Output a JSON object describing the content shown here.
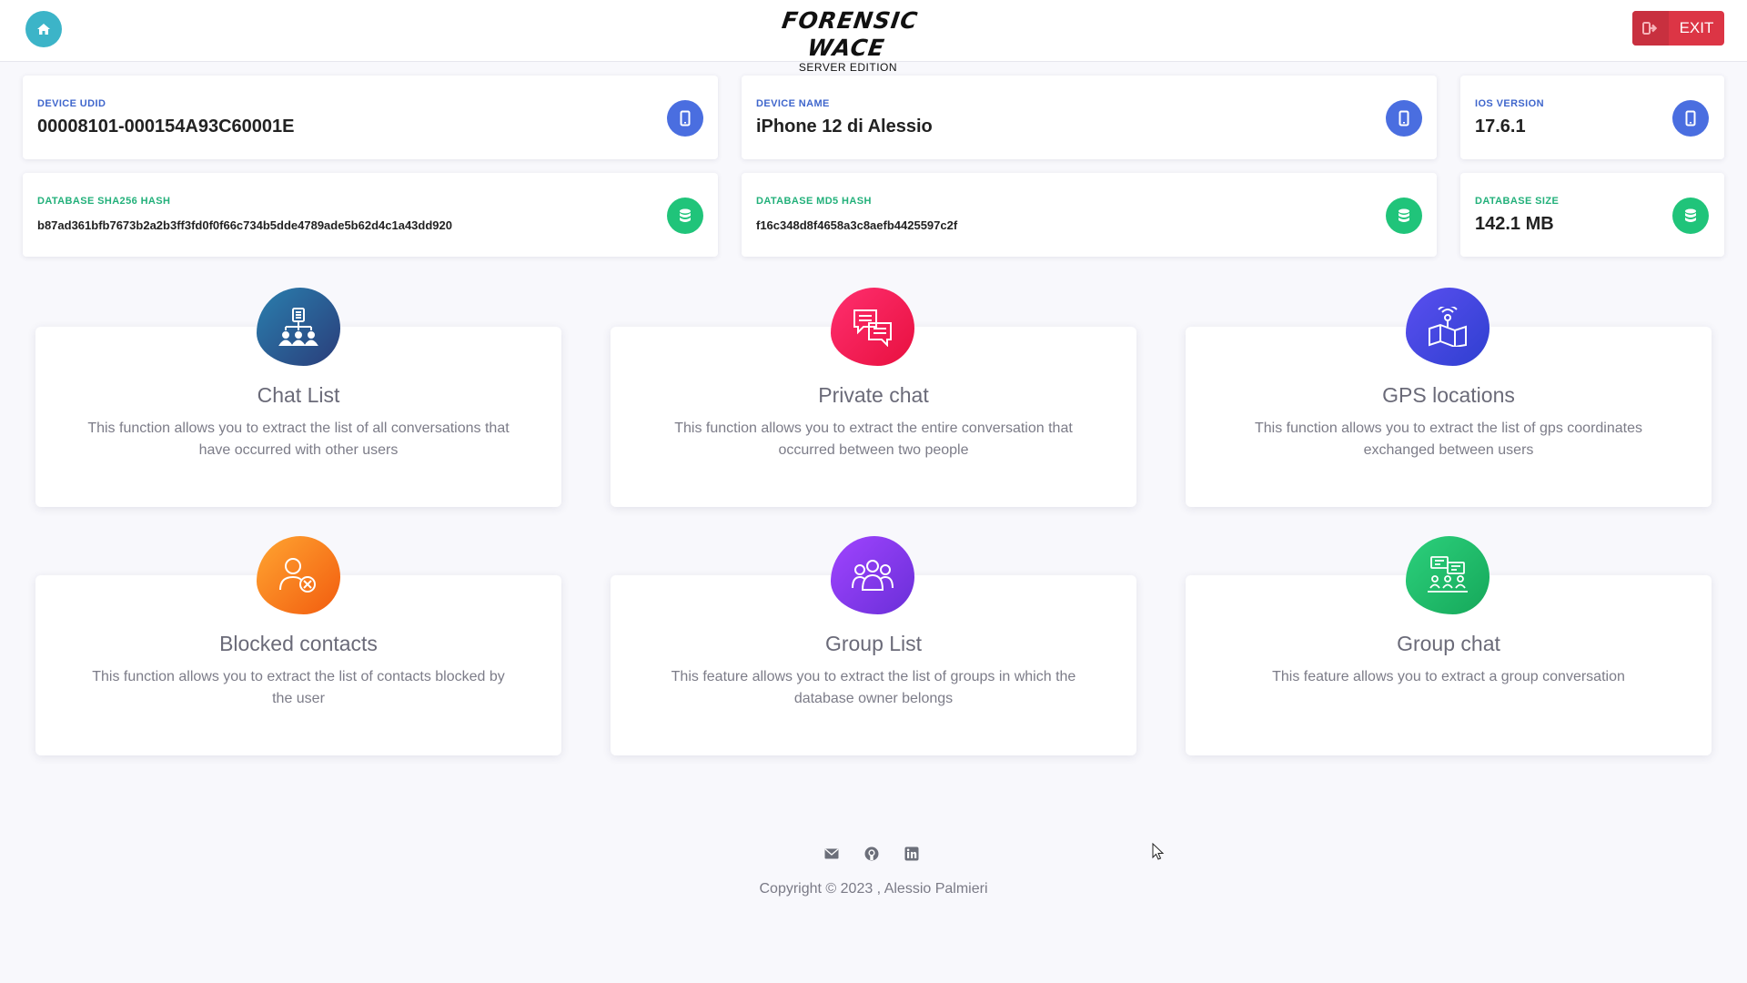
{
  "header": {
    "logo_main": "FORENSIC WACE",
    "logo_sub": "SERVER EDITION",
    "exit_label": "EXIT",
    "home_icon": "home-icon",
    "exit_icon": "sign-out-icon"
  },
  "info_cards": [
    {
      "label": "DEVICE UDID",
      "value": "00008101-000154A93C60001E",
      "icon": "mobile-icon",
      "color": "#4a6ee0"
    },
    {
      "label": "DEVICE NAME",
      "value": "iPhone 12 di Alessio",
      "icon": "mobile-icon",
      "color": "#4a6ee0"
    },
    {
      "label": "IOS VERSION",
      "value": "17.6.1",
      "icon": "mobile-icon",
      "color": "#4a6ee0"
    },
    {
      "label": "DATABASE SHA256 HASH",
      "value": "b87ad361bfb7673b2a2b3ff3fd0f0f66c734b5dde4789ade5b62d4c1a43dd920",
      "icon": "database-icon",
      "color": "#20c47a"
    },
    {
      "label": "DATABASE MD5 HASH",
      "value": "f16c348d8f4658a3c8aefb4425597c2f",
      "icon": "database-icon",
      "color": "#20c47a"
    },
    {
      "label": "DATABASE SIZE",
      "value": "142.1 MB",
      "icon": "database-icon",
      "color": "#20c47a"
    }
  ],
  "features": [
    {
      "title": "Chat List",
      "description": "This function allows you to extract the list of all conversations that have occurred with other users",
      "icon": "chat-list-icon",
      "color": "#2a5d8f"
    },
    {
      "title": "Private chat",
      "description": "This function allows you to extract the entire conversation that occurred between two people",
      "icon": "private-chat-icon",
      "color": "#f0245a"
    },
    {
      "title": "GPS locations",
      "description": "This function allows you to extract the list of gps coordinates exchanged between users",
      "icon": "gps-map-icon",
      "color": "#4747e0"
    },
    {
      "title": "Blocked contacts",
      "description": "This function allows you to extract the list of contacts blocked by the user",
      "icon": "blocked-user-icon",
      "color": "#fa7d1e"
    },
    {
      "title": "Group List",
      "description": "This feature allows you to extract the list of groups in which the database owner belongs",
      "icon": "group-icon",
      "color": "#8a3ee8"
    },
    {
      "title": "Group chat",
      "description": "This feature allows you to extract a group conversation",
      "icon": "group-chat-icon",
      "color": "#22b86a"
    }
  ],
  "footer": {
    "icons": [
      "email-icon",
      "github-icon",
      "linkedin-icon"
    ],
    "copyright": "Copyright © 2023 , Alessio Palmieri"
  }
}
